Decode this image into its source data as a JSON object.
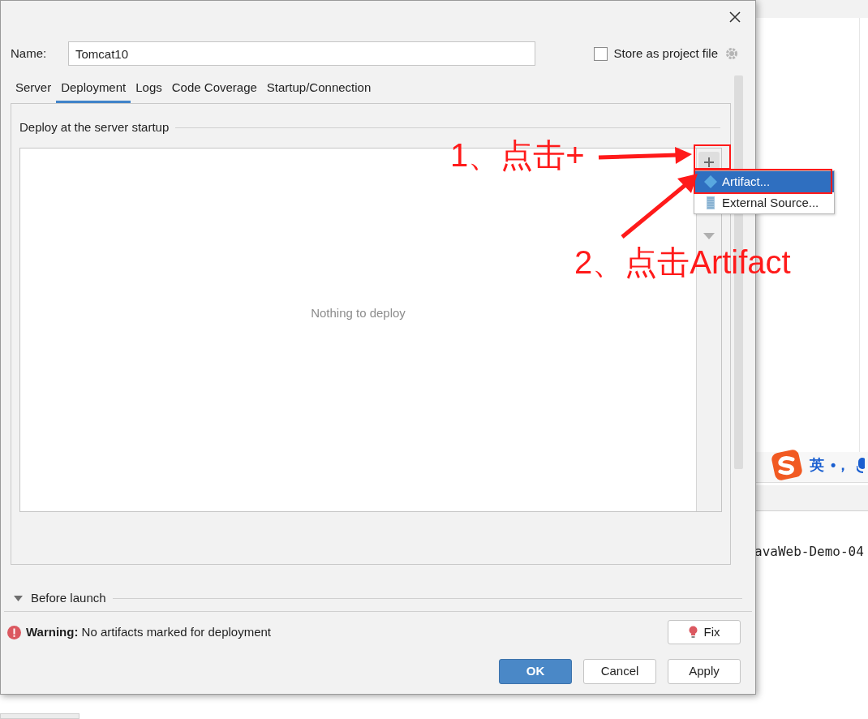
{
  "dialog": {
    "name_label": "Name:",
    "name_value": "Tomcat10",
    "store_as_project_file": {
      "label": "Store as project file",
      "checked": false
    }
  },
  "tabs": [
    {
      "label": "Server",
      "selected": false
    },
    {
      "label": "Deployment",
      "selected": true
    },
    {
      "label": "Logs",
      "selected": false
    },
    {
      "label": "Code Coverage",
      "selected": false
    },
    {
      "label": "Startup/Connection",
      "selected": false
    }
  ],
  "deployment": {
    "section_title": "Deploy at the server startup",
    "empty_text": "Nothing to deploy"
  },
  "add_menu": [
    {
      "label": "Artifact...",
      "selected": true
    },
    {
      "label": "External Source...",
      "selected": false
    }
  ],
  "before_launch": {
    "label": "Before launch",
    "expanded": true
  },
  "warning": {
    "text": "**Warning:** No artifacts marked for deployment",
    "fix_button": "Fix"
  },
  "buttons": [
    {
      "label": "OK",
      "default": true
    },
    {
      "label": "Cancel",
      "default": false
    },
    {
      "label": "Apply",
      "default": false
    }
  ],
  "annotations": [
    {
      "text": "1、点击+"
    },
    {
      "text": "2、点击Artifact"
    }
  ],
  "background": {
    "ime_language": "英",
    "ime_punct": "•，",
    "editor_text": "avaWeb-Demo-04"
  }
}
